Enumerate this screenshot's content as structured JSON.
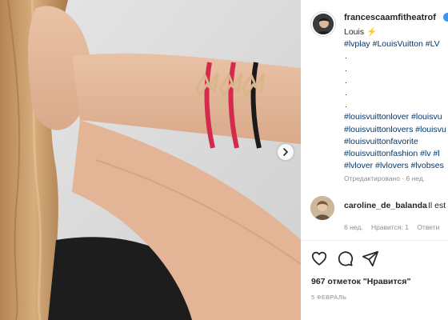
{
  "post": {
    "username": "francescaamfitheatrof",
    "verified_icon": "verified-badge-icon",
    "caption": {
      "first_line": "Louis",
      "emoji": "⚡",
      "hashtags_line1": "#lvplay #LouisVuitton #LV",
      "dots": [
        ".",
        ".",
        ".",
        ".",
        "."
      ],
      "hashtags_lines": [
        "#louisvuittonlover #louisvu",
        "#louisvuittonlovers #louisvu",
        "#louisvuittonfavorite",
        "#louisvuittonfashion #lv #l",
        "#lvlover #lvlovers #lvobses"
      ]
    },
    "edited": "Отредактировано · 6 нед."
  },
  "comment": {
    "username": "caroline_de_balanda",
    "text": "Il est",
    "time": "6 нед.",
    "likes": "Нравится: 1",
    "reply": "Ответи"
  },
  "stats": {
    "likes": "967 отметок \"Нравится\"",
    "date": "5 ФЕВРАЛЬ"
  },
  "icons": {
    "like": "heart-icon",
    "comment": "comment-icon",
    "share": "paper-plane-icon",
    "next": "chevron-right-icon"
  },
  "colors": {
    "link": "#00376b",
    "muted": "#8e8e8e",
    "verified": "#3897f0",
    "red_cord": "#d42a4c",
    "black_cord": "#1a1a1a",
    "gold": "#d9b58a"
  }
}
